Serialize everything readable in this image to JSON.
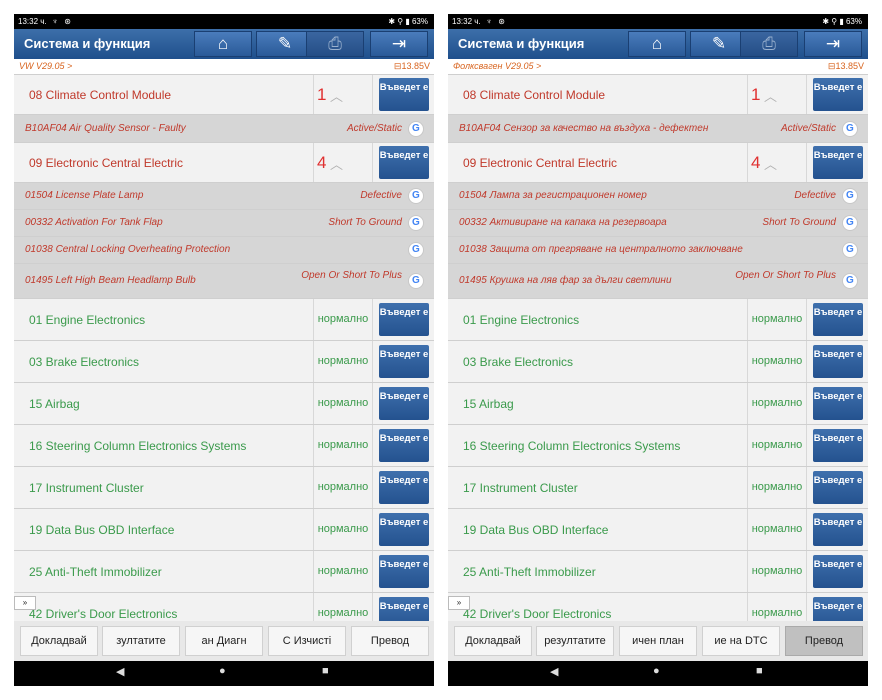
{
  "status_bar": {
    "time": "13:32 ч.",
    "battery": "63%"
  },
  "title": "Система и функция",
  "toolbar_icons": [
    "home-icon",
    "report-edit-icon",
    "print-icon",
    "exit-icon"
  ],
  "enter_label": "Въведет е",
  "voltage": "13.85V",
  "normal_label": "нормално",
  "left": {
    "version": "VW V29.05 >",
    "modules": [
      {
        "name": "08 Climate Control Module",
        "fault_count": "1"
      },
      {
        "name": "09 Electronic Central Electric",
        "fault_count": "4"
      }
    ],
    "dtcs_08": [
      {
        "code": "B10AF04 Air Quality Sensor - Faulty",
        "state": "Active/Static"
      }
    ],
    "dtcs_09": [
      {
        "code": "01504 License Plate Lamp",
        "state": "Defective"
      },
      {
        "code": "00332 Activation For Tank Flap",
        "state": "Short To Ground"
      },
      {
        "code": "01038 Central Locking Overheating Protection",
        "state": ""
      },
      {
        "code": "01495 Left High Beam Headlamp Bulb",
        "state": "Open Or Short To Plus"
      }
    ],
    "ok_modules": [
      "01 Engine Electronics",
      "03 Brake Electronics",
      "15 Airbag",
      "16 Steering Column Electronics Systems",
      "17 Instrument Cluster",
      "19 Data Bus OBD Interface",
      "25 Anti-Theft Immobilizer",
      "42 Driver's Door Electronics"
    ],
    "bottom_buttons": [
      "Докладвай",
      "зултатите",
      "ан    Диагн",
      "С    Изчисті",
      "Превод"
    ],
    "selected_button": -1
  },
  "right": {
    "version": "Фолксваген V29.05 >",
    "modules": [
      {
        "name": "08 Climate Control Module",
        "fault_count": "1"
      },
      {
        "name": "09 Electronic Central Electric",
        "fault_count": "4"
      }
    ],
    "dtcs_08": [
      {
        "code": "B10AF04 Сензор за качество на въздуха - дефектен",
        "state": "Active/Static"
      }
    ],
    "dtcs_09": [
      {
        "code": "01504 Лампа за регистрационен номер",
        "state": "Defective"
      },
      {
        "code": "00332 Активиране на капака на резервоара",
        "state": "Short To Ground"
      },
      {
        "code": "01038 Защита от прегряване на централното заключване",
        "state": ""
      },
      {
        "code": "01495 Крушка на ляв фар за дълги светлини",
        "state": "Open Or Short To Plus"
      }
    ],
    "ok_modules": [
      "01 Engine Electronics",
      "03 Brake Electronics",
      "15 Airbag",
      "16 Steering Column Electronics Systems",
      "17 Instrument Cluster",
      "19 Data Bus OBD Interface",
      "25 Anti-Theft Immobilizer",
      "42 Driver's Door Electronics"
    ],
    "bottom_buttons": [
      "Докладвай",
      "резултатите",
      "ичен план",
      "ие на DTC",
      "Превод"
    ],
    "selected_button": 4
  }
}
